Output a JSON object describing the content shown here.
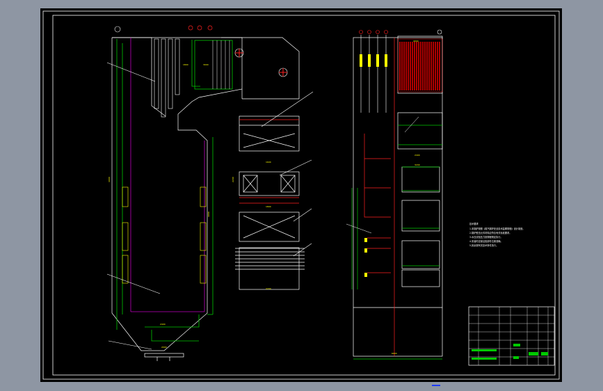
{
  "app": {
    "canvas_color": "#000000",
    "background_color": "#8e96a3",
    "layer_colors": {
      "frame": "#ffffff",
      "outline": "#ffffff",
      "walls": "#00c800",
      "tubes": "#c000c0",
      "dimensions": "#ffff00",
      "pipes": "#ff2020",
      "headers": "#e00000"
    }
  },
  "drawing": {
    "left_view": {
      "dimension_labels": [
        "4000",
        "4000",
        "2400",
        "2000",
        "1800",
        "3000"
      ]
    },
    "middle_view": {
      "dimension_labels": [
        "1600",
        "1800",
        "2200",
        "2200"
      ]
    },
    "right_view": {
      "dimension_labels": [
        "6000",
        "4000",
        "3200",
        "2400"
      ]
    },
    "notes": {
      "title": "技术要求",
      "lines": [
        "1.本锅炉按照《蒸汽锅炉安全技术监察规程》设计制造。",
        "2.锅炉受压元件材料应符合有关标准要求。",
        "3.水压试验压力按规程规定执行。",
        "4.安装时应保证各部件位置准确。",
        "5.其余按有关技术条件执行。"
      ]
    },
    "title_block": {
      "rows": [
        "",
        "",
        "",
        "",
        "",
        "",
        ""
      ],
      "number_cells": [
        "",
        "",
        "",
        "",
        ""
      ]
    }
  }
}
